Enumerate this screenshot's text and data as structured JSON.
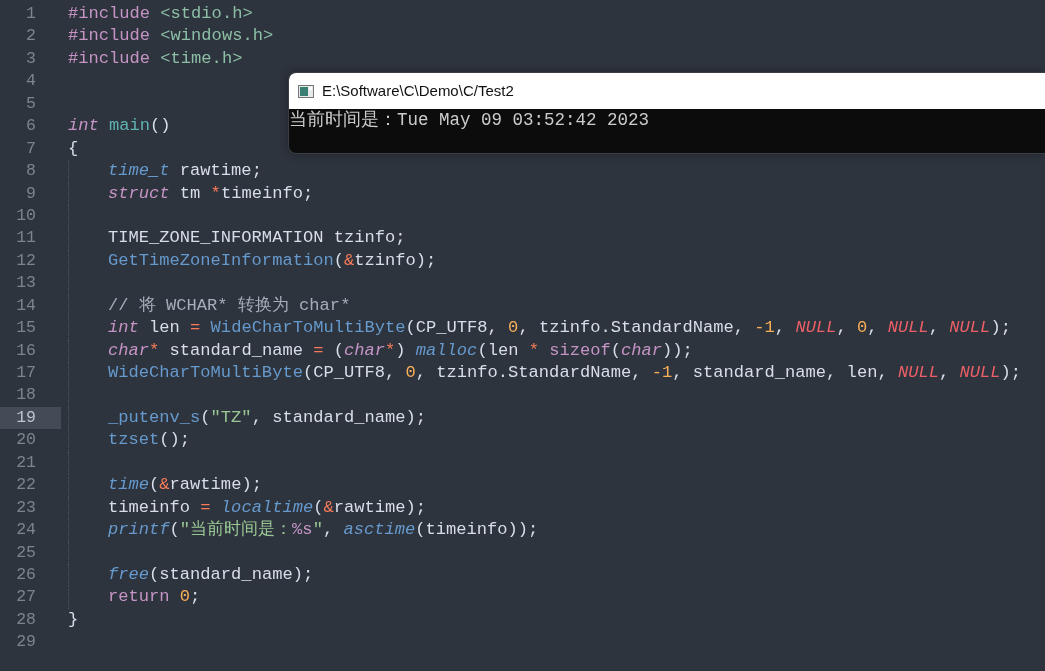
{
  "editor": {
    "lines": [
      {
        "number": "1",
        "current": false,
        "indented": false,
        "tokens": [
          {
            "kind": "keyword",
            "text": "#include "
          },
          {
            "kind": "header",
            "text": "<stdio.h>"
          }
        ]
      },
      {
        "number": "2",
        "current": false,
        "indented": false,
        "tokens": [
          {
            "kind": "keyword",
            "text": "#include "
          },
          {
            "kind": "header",
            "text": "<windows.h>"
          }
        ]
      },
      {
        "number": "3",
        "current": false,
        "indented": false,
        "tokens": [
          {
            "kind": "keyword",
            "text": "#include "
          },
          {
            "kind": "header",
            "text": "<time.h>"
          }
        ]
      },
      {
        "number": "4",
        "current": false,
        "indented": false
      },
      {
        "number": "5",
        "current": false,
        "indented": false
      },
      {
        "number": "6",
        "current": false,
        "indented": false,
        "tokens": [
          {
            "kind": "type",
            "text": "int "
          },
          {
            "kind": "entry",
            "text": "main"
          },
          {
            "kind": "plain",
            "text": "()"
          }
        ]
      },
      {
        "number": "7",
        "current": false,
        "indented": false,
        "tokens": [
          {
            "kind": "plain",
            "text": "{"
          }
        ]
      },
      {
        "number": "8",
        "current": false,
        "indented": true,
        "tokens": [
          {
            "kind": "typedef",
            "text": "time_t"
          },
          {
            "kind": "plain",
            "text": " rawtime;"
          }
        ]
      },
      {
        "number": "9",
        "current": false,
        "indented": true,
        "tokens": [
          {
            "kind": "type",
            "text": "struct"
          },
          {
            "kind": "plain",
            "text": " tm "
          },
          {
            "kind": "operator",
            "text": "*"
          },
          {
            "kind": "plain",
            "text": "timeinfo;"
          }
        ]
      },
      {
        "number": "10",
        "current": false,
        "indented": true
      },
      {
        "number": "11",
        "current": false,
        "indented": true,
        "tokens": [
          {
            "kind": "plain",
            "text": "TIME_ZONE_INFORMATION tzinfo;"
          }
        ]
      },
      {
        "number": "12",
        "current": false,
        "indented": true,
        "tokens": [
          {
            "kind": "function",
            "text": "GetTimeZoneInformation"
          },
          {
            "kind": "plain",
            "text": "("
          },
          {
            "kind": "operator",
            "text": "&"
          },
          {
            "kind": "plain",
            "text": "tzinfo);"
          }
        ]
      },
      {
        "number": "13",
        "current": false,
        "indented": true
      },
      {
        "number": "14",
        "current": false,
        "indented": true,
        "tokens": [
          {
            "kind": "comment",
            "text": "// 将 WCHAR* 转换为 char*"
          }
        ]
      },
      {
        "number": "15",
        "current": false,
        "indented": true,
        "tokens": [
          {
            "kind": "type",
            "text": "int"
          },
          {
            "kind": "plain",
            "text": " len "
          },
          {
            "kind": "operator",
            "text": "= "
          },
          {
            "kind": "function",
            "text": "WideCharToMultiByte"
          },
          {
            "kind": "plain",
            "text": "(CP_UTF8, "
          },
          {
            "kind": "number",
            "text": "0"
          },
          {
            "kind": "plain",
            "text": ", tzinfo.StandardName, "
          },
          {
            "kind": "number",
            "text": "-1"
          },
          {
            "kind": "plain",
            "text": ", "
          },
          {
            "kind": "constant",
            "text": "NULL"
          },
          {
            "kind": "plain",
            "text": ", "
          },
          {
            "kind": "number",
            "text": "0"
          },
          {
            "kind": "plain",
            "text": ", "
          },
          {
            "kind": "constant",
            "text": "NULL"
          },
          {
            "kind": "plain",
            "text": ", "
          },
          {
            "kind": "constant",
            "text": "NULL"
          },
          {
            "kind": "plain",
            "text": ");"
          }
        ]
      },
      {
        "number": "16",
        "current": false,
        "indented": true,
        "tokens": [
          {
            "kind": "type",
            "text": "char"
          },
          {
            "kind": "operator",
            "text": "*"
          },
          {
            "kind": "plain",
            "text": " standard_name "
          },
          {
            "kind": "operator",
            "text": "= "
          },
          {
            "kind": "plain",
            "text": "("
          },
          {
            "kind": "type",
            "text": "char"
          },
          {
            "kind": "operator",
            "text": "*"
          },
          {
            "kind": "plain",
            "text": ") "
          },
          {
            "kind": "builtin",
            "text": "malloc"
          },
          {
            "kind": "plain",
            "text": "(len "
          },
          {
            "kind": "operator",
            "text": "* "
          },
          {
            "kind": "keyword",
            "text": "sizeof"
          },
          {
            "kind": "plain",
            "text": "("
          },
          {
            "kind": "type",
            "text": "char"
          },
          {
            "kind": "plain",
            "text": "));"
          }
        ]
      },
      {
        "number": "17",
        "current": false,
        "indented": true,
        "tokens": [
          {
            "kind": "function",
            "text": "WideCharToMultiByte"
          },
          {
            "kind": "plain",
            "text": "(CP_UTF8, "
          },
          {
            "kind": "number",
            "text": "0"
          },
          {
            "kind": "plain",
            "text": ", tzinfo.StandardName, "
          },
          {
            "kind": "number",
            "text": "-1"
          },
          {
            "kind": "plain",
            "text": ", standard_name, len, "
          },
          {
            "kind": "constant",
            "text": "NULL"
          },
          {
            "kind": "plain",
            "text": ", "
          },
          {
            "kind": "constant",
            "text": "NULL"
          },
          {
            "kind": "plain",
            "text": ");"
          }
        ]
      },
      {
        "number": "18",
        "current": false,
        "indented": true
      },
      {
        "number": "19",
        "current": true,
        "indented": true,
        "tokens": [
          {
            "kind": "function",
            "text": "_putenv_s"
          },
          {
            "kind": "plain",
            "text": "("
          },
          {
            "kind": "string",
            "text": "\"TZ\""
          },
          {
            "kind": "plain",
            "text": ", standard_name);"
          }
        ]
      },
      {
        "number": "20",
        "current": false,
        "indented": true,
        "tokens": [
          {
            "kind": "function",
            "text": "tzset"
          },
          {
            "kind": "plain",
            "text": "();"
          }
        ]
      },
      {
        "number": "21",
        "current": false,
        "indented": true
      },
      {
        "number": "22",
        "current": false,
        "indented": true,
        "tokens": [
          {
            "kind": "builtin",
            "text": "time"
          },
          {
            "kind": "plain",
            "text": "("
          },
          {
            "kind": "operator",
            "text": "&"
          },
          {
            "kind": "plain",
            "text": "rawtime);"
          }
        ]
      },
      {
        "number": "23",
        "current": false,
        "indented": true,
        "tokens": [
          {
            "kind": "plain",
            "text": "timeinfo "
          },
          {
            "kind": "operator",
            "text": "= "
          },
          {
            "kind": "builtin",
            "text": "localtime"
          },
          {
            "kind": "plain",
            "text": "("
          },
          {
            "kind": "operator",
            "text": "&"
          },
          {
            "kind": "plain",
            "text": "rawtime);"
          }
        ]
      },
      {
        "number": "24",
        "current": false,
        "indented": true,
        "tokens": [
          {
            "kind": "builtin",
            "text": "printf"
          },
          {
            "kind": "plain",
            "text": "("
          },
          {
            "kind": "string",
            "text": "\"当前时间是："
          },
          {
            "kind": "escape",
            "text": "%s"
          },
          {
            "kind": "string",
            "text": "\""
          },
          {
            "kind": "plain",
            "text": ", "
          },
          {
            "kind": "builtin",
            "text": "asctime"
          },
          {
            "kind": "plain",
            "text": "(timeinfo));"
          }
        ]
      },
      {
        "number": "25",
        "current": false,
        "indented": true
      },
      {
        "number": "26",
        "current": false,
        "indented": true,
        "tokens": [
          {
            "kind": "builtin",
            "text": "free"
          },
          {
            "kind": "plain",
            "text": "(standard_name);"
          }
        ]
      },
      {
        "number": "27",
        "current": false,
        "indented": true,
        "tokens": [
          {
            "kind": "keyword",
            "text": "return "
          },
          {
            "kind": "number",
            "text": "0"
          },
          {
            "kind": "plain",
            "text": ";"
          }
        ]
      },
      {
        "number": "28",
        "current": false,
        "indented": false,
        "tokens": [
          {
            "kind": "plain",
            "text": "}"
          }
        ]
      },
      {
        "number": "29",
        "current": false,
        "indented": false
      }
    ]
  },
  "console_window": {
    "title": "E:\\Software\\C\\Demo\\C/Test2",
    "output": "当前时间是：Tue May 09 03:52:42 2023"
  }
}
